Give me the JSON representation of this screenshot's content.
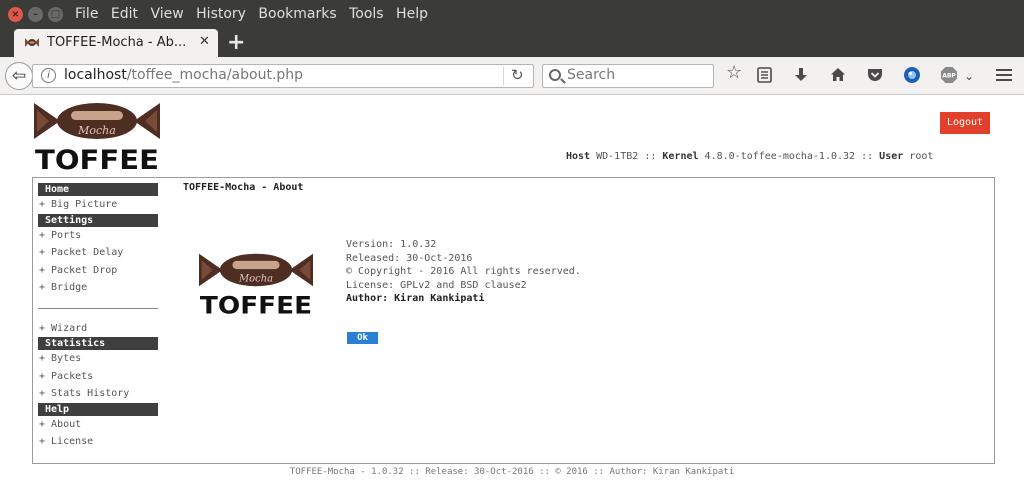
{
  "window": {
    "menu": [
      "File",
      "Edit",
      "View",
      "History",
      "Bookmarks",
      "Tools",
      "Help"
    ]
  },
  "tab": {
    "title": "TOFFEE-Mocha - Ab...",
    "close_glyph": "✕",
    "new_tab_glyph": "+"
  },
  "navbar": {
    "url_host": "localhost",
    "url_path": "/toffee_mocha/about.php",
    "search_placeholder": "Search",
    "icons": [
      "back-icon",
      "info-icon",
      "reload-icon",
      "search-icon",
      "bookmark-star-icon",
      "reading-list-icon",
      "download-icon",
      "home-icon",
      "pocket-icon",
      "extension-icon",
      "adblock-icon",
      "menu-icon"
    ]
  },
  "logo": {
    "wordmark": "TOFFEE",
    "script": "Mocha",
    "colors": {
      "brown_dark": "#4e2e23",
      "brown_mid": "#7a4a38",
      "cream": "#c7a38c"
    }
  },
  "header": {
    "logout_label": "Logout",
    "host_label": "Host",
    "host_value": "WD-1TB2",
    "kernel_label": "Kernel",
    "kernel_value": "4.8.0-toffee-mocha-1.0.32",
    "user_label": "User",
    "user_value": "root",
    "separator": "::",
    "logout_color": "#e2402a"
  },
  "sidebar": {
    "home": {
      "title": "Home",
      "items": [
        "+ Big Picture"
      ]
    },
    "settings": {
      "title": "Settings",
      "items": [
        "+ Ports",
        "+ Packet Delay",
        "+ Packet Drop",
        "+ Bridge"
      ]
    },
    "extra_items": [
      "+ Wizard"
    ],
    "statistics": {
      "title": "Statistics",
      "items": [
        "+ Bytes",
        "+ Packets",
        "+ Stats History"
      ]
    },
    "help": {
      "title": "Help",
      "items": [
        "+ About",
        "+ License"
      ]
    }
  },
  "about": {
    "heading": "TOFFEE-Mocha - About",
    "version": "Version: 1.0.32",
    "released": "Released: 30-Oct-2016",
    "copyright": "© Copyright - 2016 All rights reserved.",
    "license": "License: GPLv2 and BSD clause2",
    "author": "Author: Kiran Kankipati",
    "ok_label": "Ok",
    "ok_color": "#2a7fd4"
  },
  "footer": {
    "text": "TOFFEE-Mocha - 1.0.32 :: Release: 30-Oct-2016 :: © 2016 :: Author: Kiran Kankipati"
  }
}
